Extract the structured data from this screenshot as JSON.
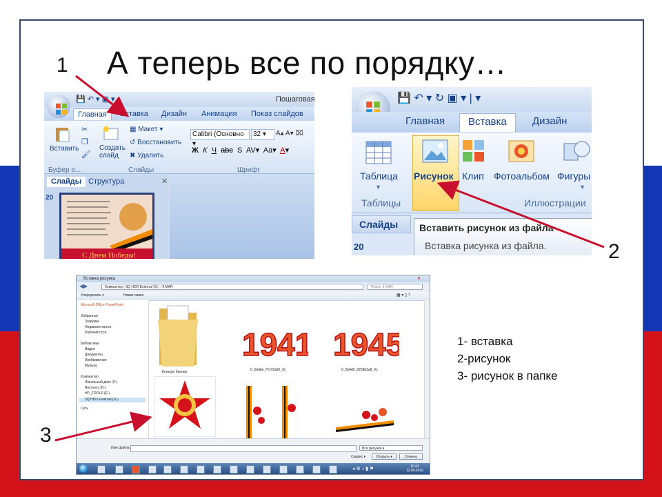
{
  "title": "А теперь все по порядку…",
  "markers": {
    "n1": "1",
    "n2": "2",
    "n3": "3"
  },
  "legend": [
    "1- вставка",
    "2-рисунок",
    "3- рисунок в папке"
  ],
  "colors": {
    "flag_white": "#ffffff",
    "flag_blue": "#1336b5",
    "flag_red": "#d4121a",
    "arrow": "#c8102e"
  },
  "shot1": {
    "window_title": "Пошаговая",
    "tabs": [
      "Главная",
      "Вставка",
      "Дизайн",
      "Анимация",
      "Показ слайдов"
    ],
    "active_tab": "Главная",
    "paste": "Вставить",
    "new_slide": "Создать слайд",
    "layout": "Макет",
    "reset": "Восстановить",
    "delete": "Удалить",
    "font_name": "Calibri (Основно",
    "font_size": "32",
    "groups": {
      "clipboard": "Буфер о...",
      "slides": "Слайды",
      "font": "Шрифт"
    },
    "panel_tabs": [
      "Слайды",
      "Структура"
    ],
    "slide_number": "20",
    "thumb_caption": "С Днем Победы!"
  },
  "shot2": {
    "tabs": [
      "Главная",
      "Вставка",
      "Дизайн"
    ],
    "active_tab": "Вставка",
    "buttons": [
      "Таблица",
      "Рисунок",
      "Клип",
      "Фотоальбом",
      "Фигуры"
    ],
    "groups": {
      "tables": "Таблицы",
      "illustrations": "Иллюстрации"
    },
    "slides_tab": "Слайды",
    "slide_number": "20",
    "tooltip_title": "Вставить рисунок из файла",
    "tooltip_text": "Вставка рисунка из файла."
  },
  "shot3": {
    "window_title": "Вставка рисунка",
    "address": "Компьютер › 3Q HDD External (G:) › 9 MAR",
    "search_placeholder": "Поиск: 9 MAR",
    "toolbar": [
      "Упорядочить ▾",
      "Новая папка"
    ],
    "nav": {
      "top": "Microsoft Office PowerPoint",
      "favorites": "Избранное",
      "fav_items": [
        "Загрузки",
        "Недавние места",
        "Рабочий стол"
      ],
      "libraries": "Библиотеки",
      "lib_items": [
        "Видео",
        "Документы",
        "Изображения",
        "Музыка"
      ],
      "computer": "Компьютер",
      "comp_items": [
        "Локальный диск (C:)",
        "Recovery (D:)",
        "HP_TOOLS (E:)",
        "3Q HDD External (G:)"
      ],
      "network": "Сеть"
    },
    "files": [
      "Конкурс баннер",
      "0_5b4be_f7d72a96_XL",
      "0_5b4d0_2209b3a8_XL"
    ],
    "year1": "1941",
    "year2": "1945",
    "filename_label": "Имя файла:",
    "filetype": "Все рисунки",
    "service": "Сервис",
    "open": "Открыть",
    "cancel": "Отмена",
    "clock_time": "10:41",
    "clock_date": "12.04.2016"
  }
}
